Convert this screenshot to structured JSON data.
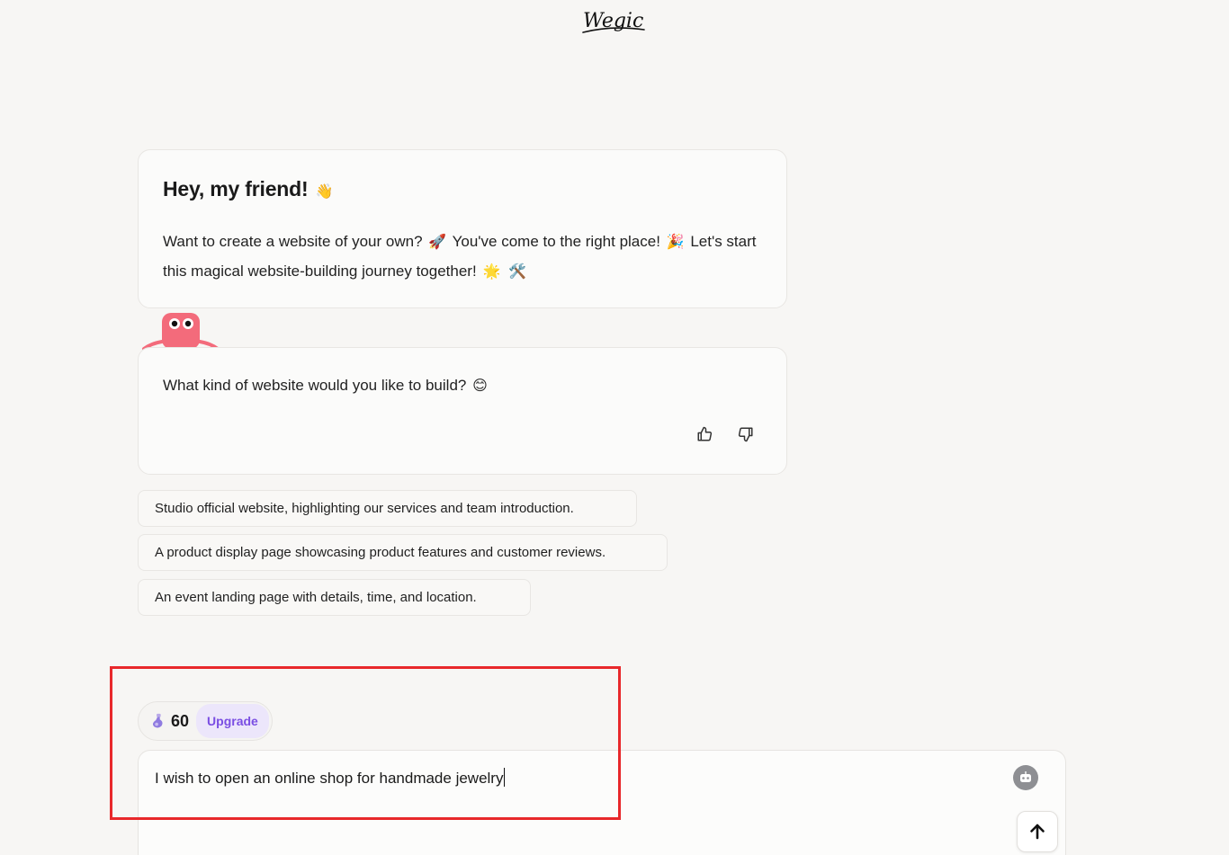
{
  "header": {
    "logo_text": "Wegic"
  },
  "greeting": {
    "title": "Hey, my friend!",
    "title_emoji": "👋",
    "line_part1": "Want to create a website of your own?",
    "emoji_rocket": "🚀",
    "line_part2": "You've come to the right place!",
    "emoji_party": "🎉",
    "line_part3": "Let's start this magical website-building journey together!",
    "emoji_sparkle": "🌟",
    "emoji_tools": "🛠️"
  },
  "question": {
    "text": "What kind of website would you like to build?",
    "emoji": "😊",
    "feedback": {
      "up_icon": "thumbs-up-icon",
      "down_icon": "thumbs-down-icon"
    }
  },
  "suggestions": [
    "Studio official website, highlighting our services and team introduction.",
    "A product display page showcasing product features and customer reviews.",
    "An event landing page with details, time, and location."
  ],
  "credits": {
    "count": "60",
    "upgrade_label": "Upgrade",
    "icon": "potion-icon"
  },
  "composer": {
    "value": "I wish to open an online shop for handmade jewelry",
    "assistant_icon": "robot-icon",
    "send_icon": "arrow-up-icon"
  },
  "colors": {
    "background": "#f7f6f4",
    "upgrade_text": "#7a4ee3",
    "upgrade_bg": "#ece6fb",
    "highlight": "#e8282b"
  }
}
